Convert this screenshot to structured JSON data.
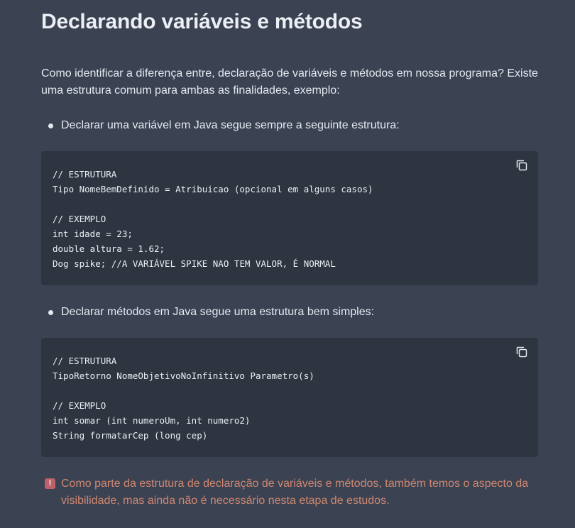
{
  "heading": "Declarando variáveis e métodos",
  "intro": "Como identificar a diferença entre, declaração de variáveis e métodos em nossa programa? Existe uma estrutura comum para ambas as finalidades, exemplo:",
  "bullets": [
    {
      "text": "Declarar uma variável em Java segue sempre a seguinte estrutura:"
    },
    {
      "text": "Declarar métodos em Java segue uma estrutura bem simples:"
    }
  ],
  "code_blocks": [
    {
      "code": "// ESTRUTURA\nTipo NomeBemDefinido = Atribuicao (opcional em alguns casos)\n\n// EXEMPLO\nint idade = 23;\ndouble altura = 1.62;\nDog spike; //A VARIÁVEL SPIKE NAO TEM VALOR, É NORMAL",
      "copy_icon": "copy-icon"
    },
    {
      "code": "// ESTRUTURA\nTipoRetorno NomeObjetivoNoInfinitivo Parametro(s)\n\n// EXEMPLO\nint somar (int numeroUm, int numero2)\nString formatarCep (long cep)",
      "copy_icon": "copy-icon"
    }
  ],
  "warning": {
    "icon": "!",
    "text": "Como parte da estrutura de declaração de variáveis e métodos, também temos o aspecto da visibilidade, mas ainda não é necessário nesta etapa de estudos."
  },
  "colors": {
    "background": "#3b4252",
    "code_background": "#2e3440",
    "text": "#e5e9f0",
    "warning_text": "#d08770",
    "warning_icon": "#bf616a"
  }
}
